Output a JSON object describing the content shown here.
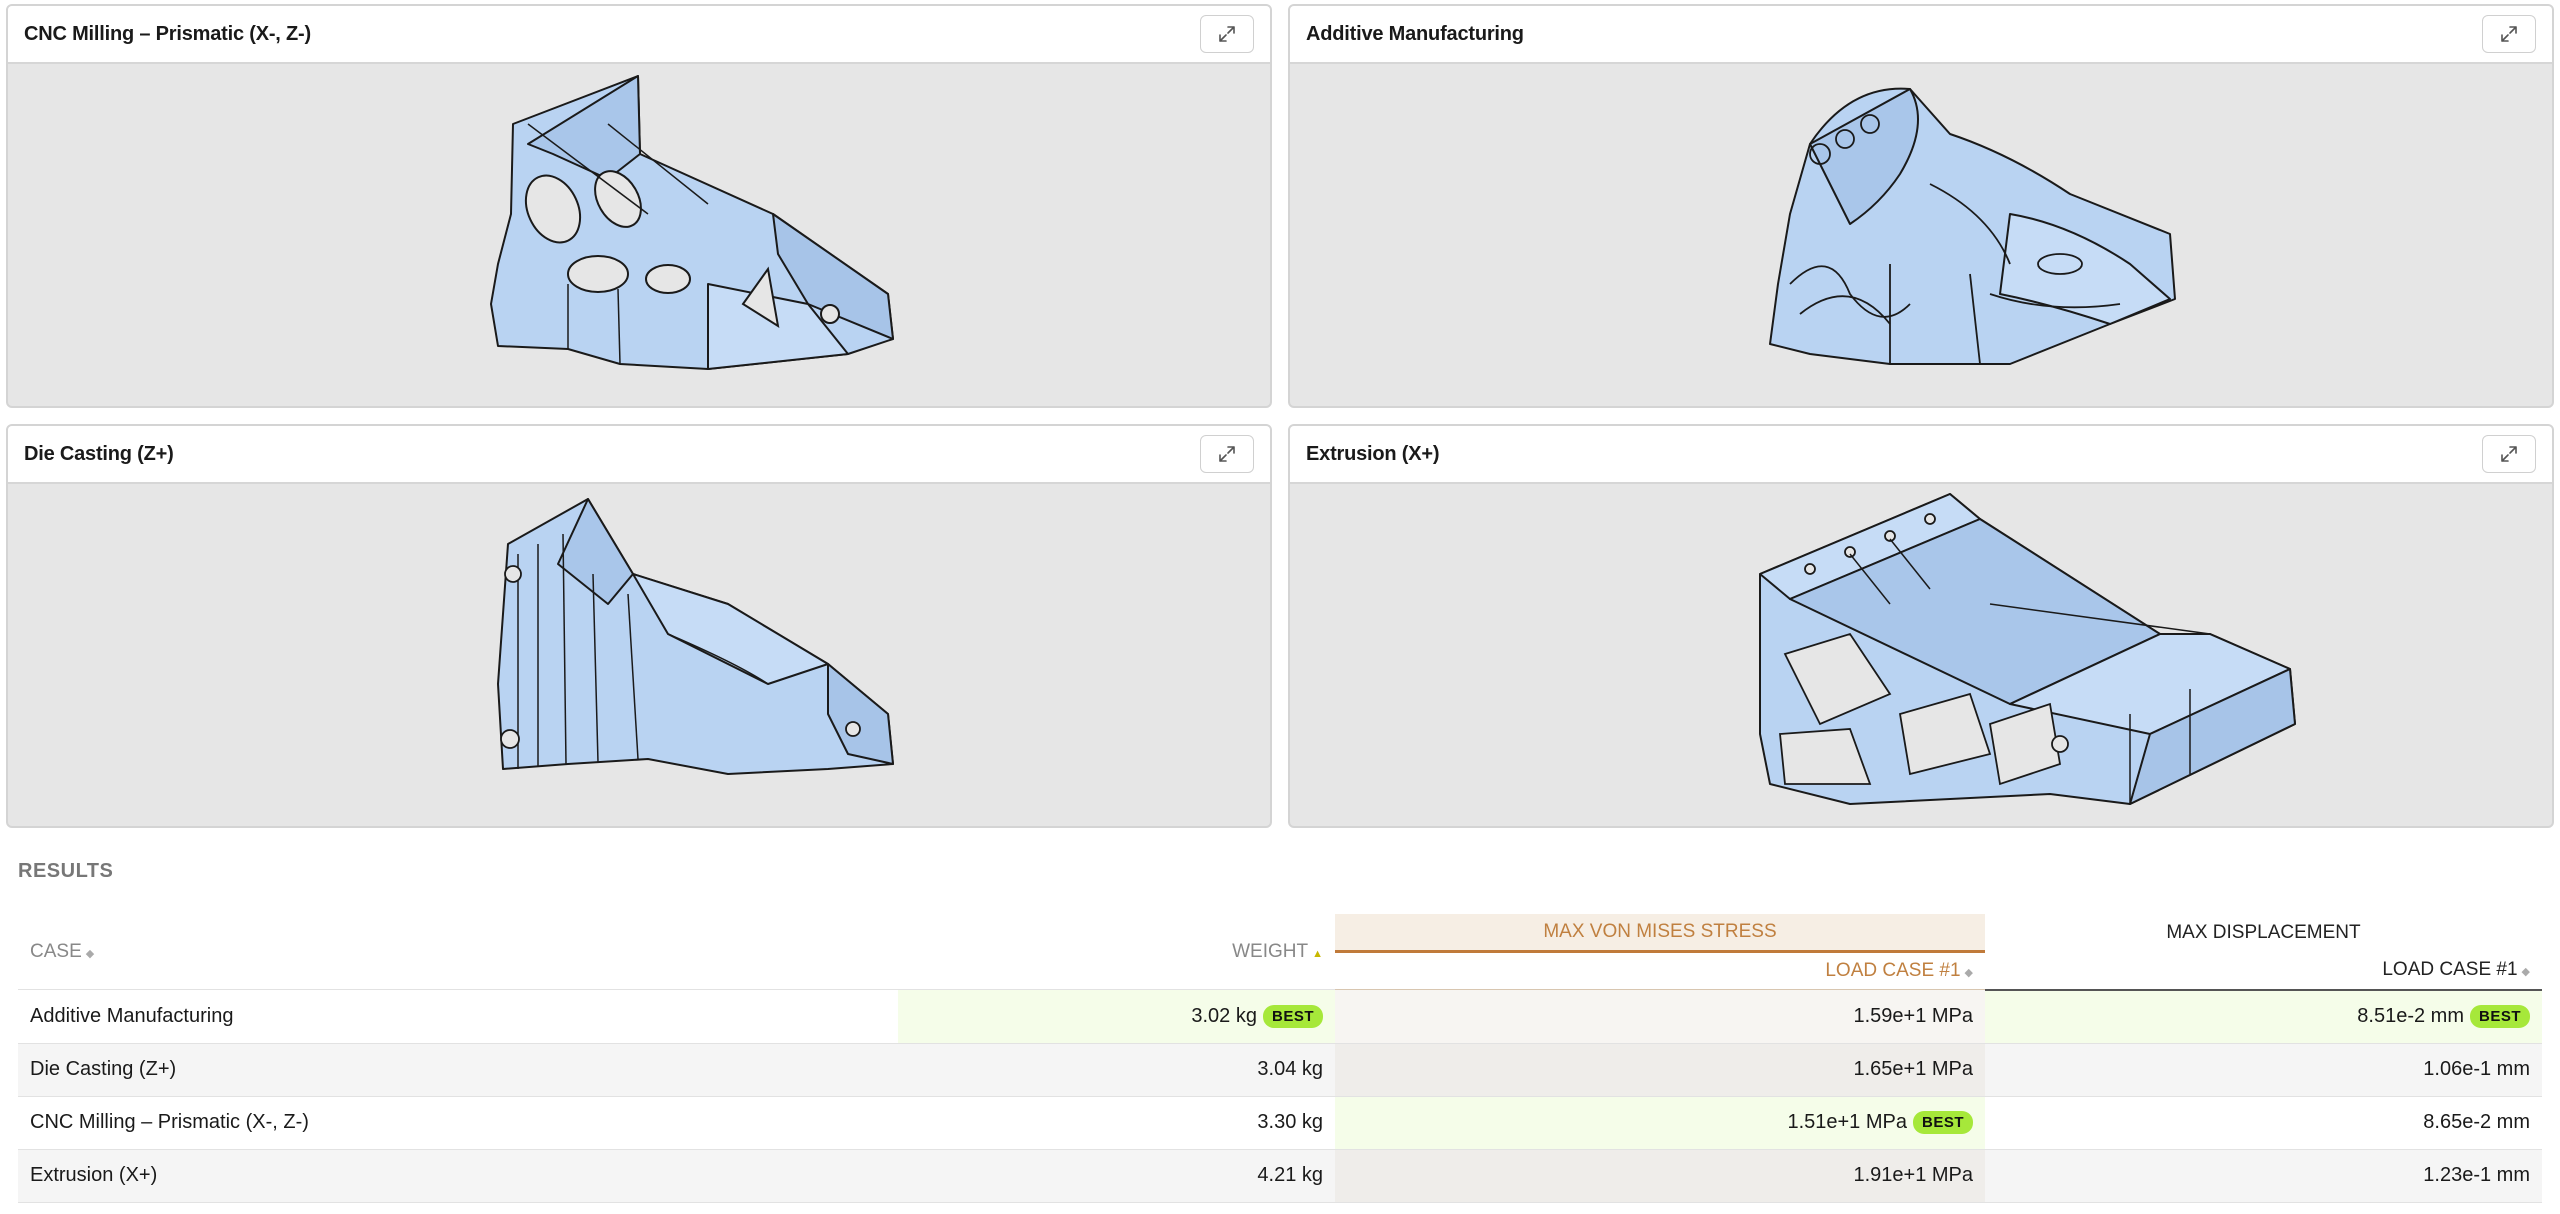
{
  "panels": [
    {
      "title": "CNC Milling – Prismatic (X-, Z-)",
      "icon": "expand-icon"
    },
    {
      "title": "Additive Manufacturing",
      "icon": "expand-icon"
    },
    {
      "title": "Die Casting (Z+)",
      "icon": "expand-icon"
    },
    {
      "title": "Extrusion (X+)",
      "icon": "expand-icon"
    }
  ],
  "results": {
    "title": "RESULTS",
    "headers": {
      "case": "CASE",
      "weight": "WEIGHT",
      "stress_group": "MAX VON MISES STRESS",
      "displacement_group": "MAX DISPLACEMENT",
      "stress_sub": "LOAD CASE #1",
      "displacement_sub": "LOAD CASE #1"
    },
    "sort_icons": {
      "case": "◆",
      "weight": "▲",
      "stress": "◆",
      "displacement": "◆"
    },
    "best_label": "BEST",
    "rows": [
      {
        "case": "Additive Manufacturing",
        "weight": "3.02 kg",
        "stress": "1.59e+1 MPa",
        "displacement": "8.51e-2 mm"
      },
      {
        "case": "Die Casting (Z+)",
        "weight": "3.04 kg",
        "stress": "1.65e+1 MPa",
        "displacement": "1.06e-1 mm"
      },
      {
        "case": "CNC Milling – Prismatic (X-, Z-)",
        "weight": "3.30 kg",
        "stress": "1.51e+1 MPa",
        "displacement": "8.65e-2 mm"
      },
      {
        "case": "Extrusion (X+)",
        "weight": "4.21 kg",
        "stress": "1.91e+1 MPa",
        "displacement": "1.23e-1 mm"
      }
    ]
  },
  "colors": {
    "part_fill": "#b9d3f2",
    "part_stroke": "#1a1a1a",
    "viewport_bg": "#e6e6e6",
    "best_badge": "#a6e83a",
    "stress_accent": "#c07a3a"
  }
}
